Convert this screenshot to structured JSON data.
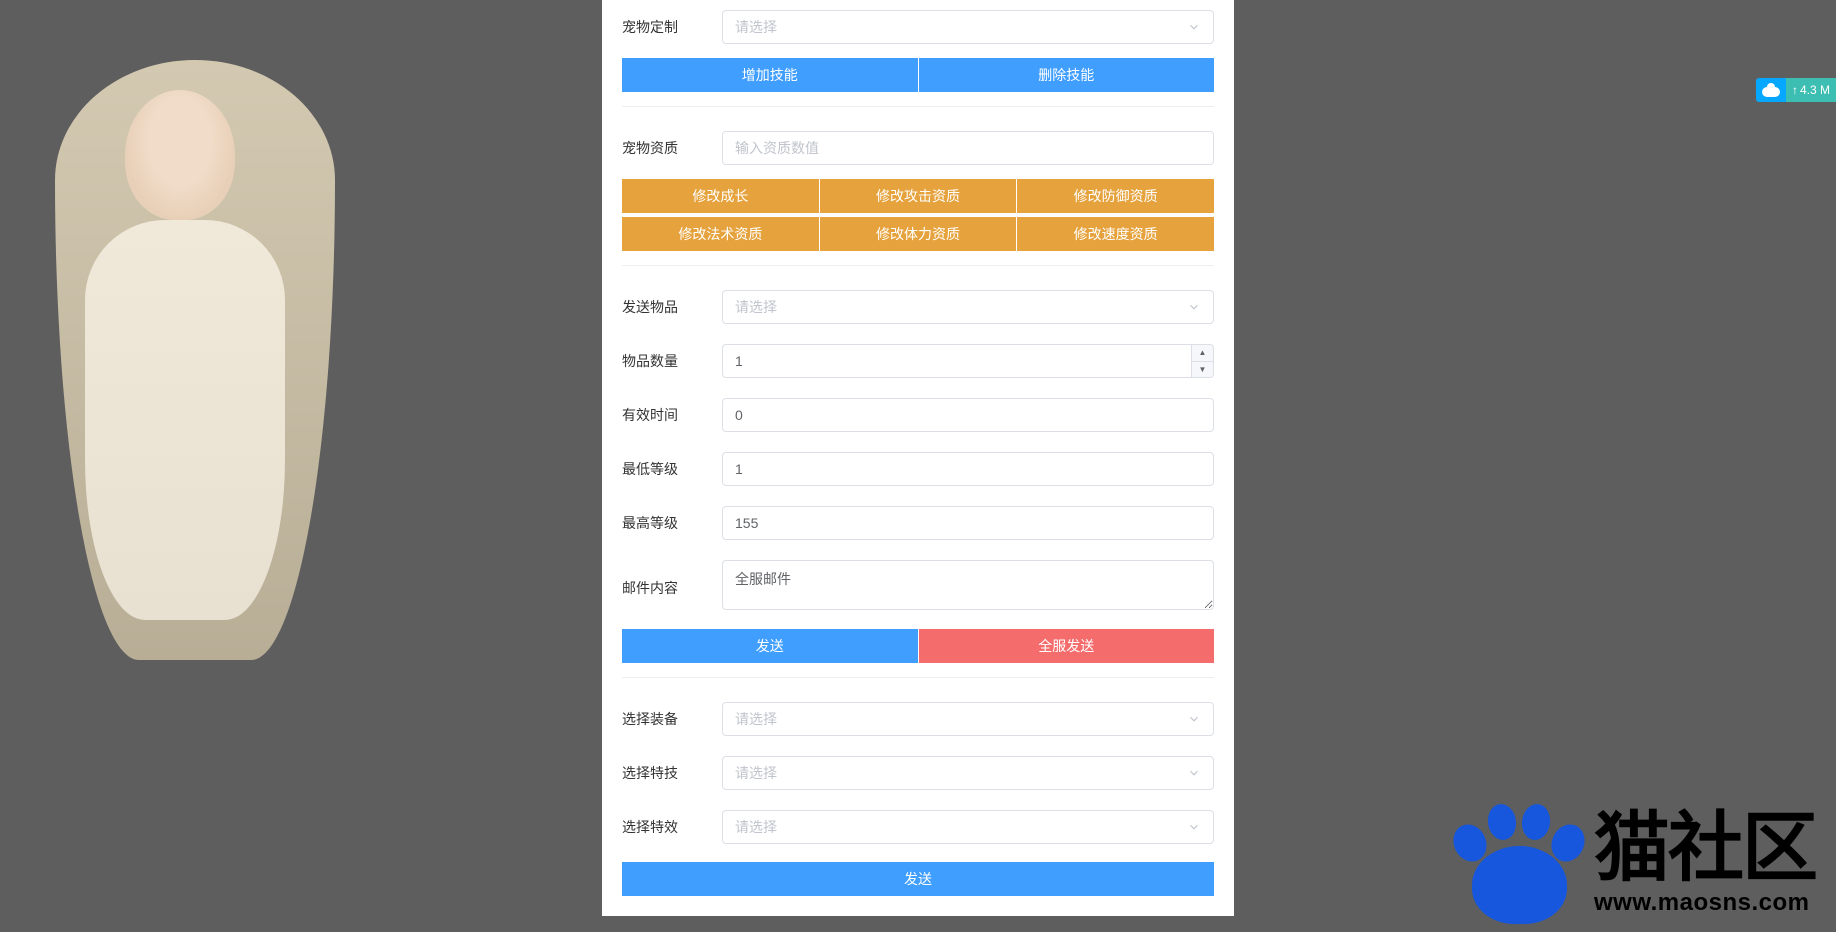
{
  "section1": {
    "pet_custom_label": "宠物定制",
    "select_placeholder": "请选择",
    "add_skill_btn": "增加技能",
    "remove_skill_btn": "删除技能"
  },
  "section2": {
    "pet_qualification_label": "宠物资质",
    "input_placeholder": "输入资质数值",
    "modify_growth": "修改成长",
    "modify_attack": "修改攻击资质",
    "modify_defense": "修改防御资质",
    "modify_magic": "修改法术资质",
    "modify_stamina": "修改体力资质",
    "modify_speed": "修改速度资质"
  },
  "section3": {
    "send_item_label": "发送物品",
    "select_placeholder": "请选择",
    "item_qty_label": "物品数量",
    "item_qty_value": "1",
    "valid_time_label": "有效时间",
    "valid_time_value": "0",
    "min_level_label": "最低等级",
    "min_level_value": "1",
    "max_level_label": "最高等级",
    "max_level_value": "155",
    "mail_content_label": "邮件内容",
    "mail_content_value": "全服邮件",
    "send_btn": "发送",
    "send_all_btn": "全服发送"
  },
  "section4": {
    "select_equip_label": "选择装备",
    "select_special_label": "选择特技",
    "select_effect_label": "选择特效",
    "select_placeholder": "请选择",
    "send_btn": "发送"
  },
  "watermark": {
    "title": "猫社区",
    "url": "www.maosns.com"
  },
  "top_widget": {
    "speed": "4.3 M"
  }
}
